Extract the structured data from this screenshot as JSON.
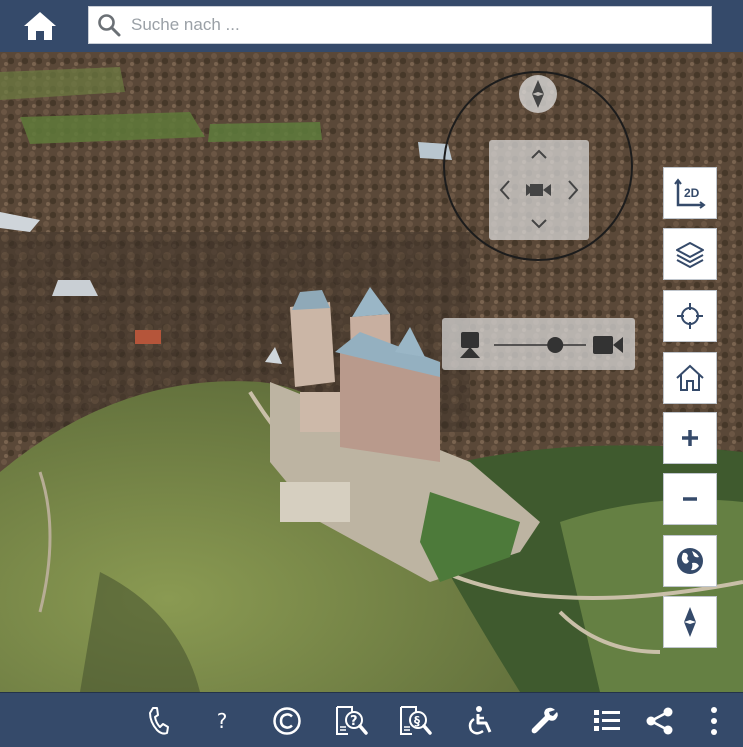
{
  "header": {
    "home_icon": "home-icon",
    "search": {
      "placeholder": "Suche nach ...",
      "value": "",
      "icon": "search-icon"
    }
  },
  "map": {
    "navigation": {
      "compass_icon": "compass-icon",
      "pan_icons": [
        "chevron-up-icon",
        "chevron-left-icon",
        "camera-icon",
        "chevron-right-icon",
        "chevron-down-icon"
      ],
      "tilt_icons": [
        "pedestrian-view-icon",
        "camera-view-icon"
      ],
      "tilt_level": 0.7
    },
    "toolbar": [
      {
        "id": "toggle-2d",
        "label": "2D",
        "icon": "2d-axis-icon"
      },
      {
        "id": "layers",
        "icon": "layers-icon"
      },
      {
        "id": "locate",
        "icon": "crosshair-icon"
      },
      {
        "id": "home-view",
        "icon": "house-icon"
      },
      {
        "id": "zoom-in",
        "label": "+",
        "icon": "plus-icon"
      },
      {
        "id": "zoom-out",
        "label": "–",
        "icon": "minus-icon"
      },
      {
        "id": "globe",
        "icon": "globe-icon"
      },
      {
        "id": "north",
        "icon": "north-arrow-icon"
      }
    ]
  },
  "footer": {
    "items": [
      {
        "id": "contact",
        "icon": "phone-icon"
      },
      {
        "id": "help",
        "label": "?",
        "icon": "question-icon"
      },
      {
        "id": "copyright",
        "icon": "copyright-icon"
      },
      {
        "id": "faq-search",
        "icon": "doc-question-search-icon"
      },
      {
        "id": "legal-search",
        "icon": "doc-paragraph-search-icon"
      },
      {
        "id": "accessibility",
        "icon": "wheelchair-icon"
      },
      {
        "id": "tools",
        "icon": "wrench-icon"
      },
      {
        "id": "list",
        "icon": "list-icon"
      },
      {
        "id": "share",
        "icon": "share-icon"
      },
      {
        "id": "more",
        "icon": "more-vertical-icon"
      }
    ]
  },
  "colors": {
    "bar": "#354a6a",
    "button_bg": "#ffffff",
    "icon_dark": "#354a6a"
  }
}
